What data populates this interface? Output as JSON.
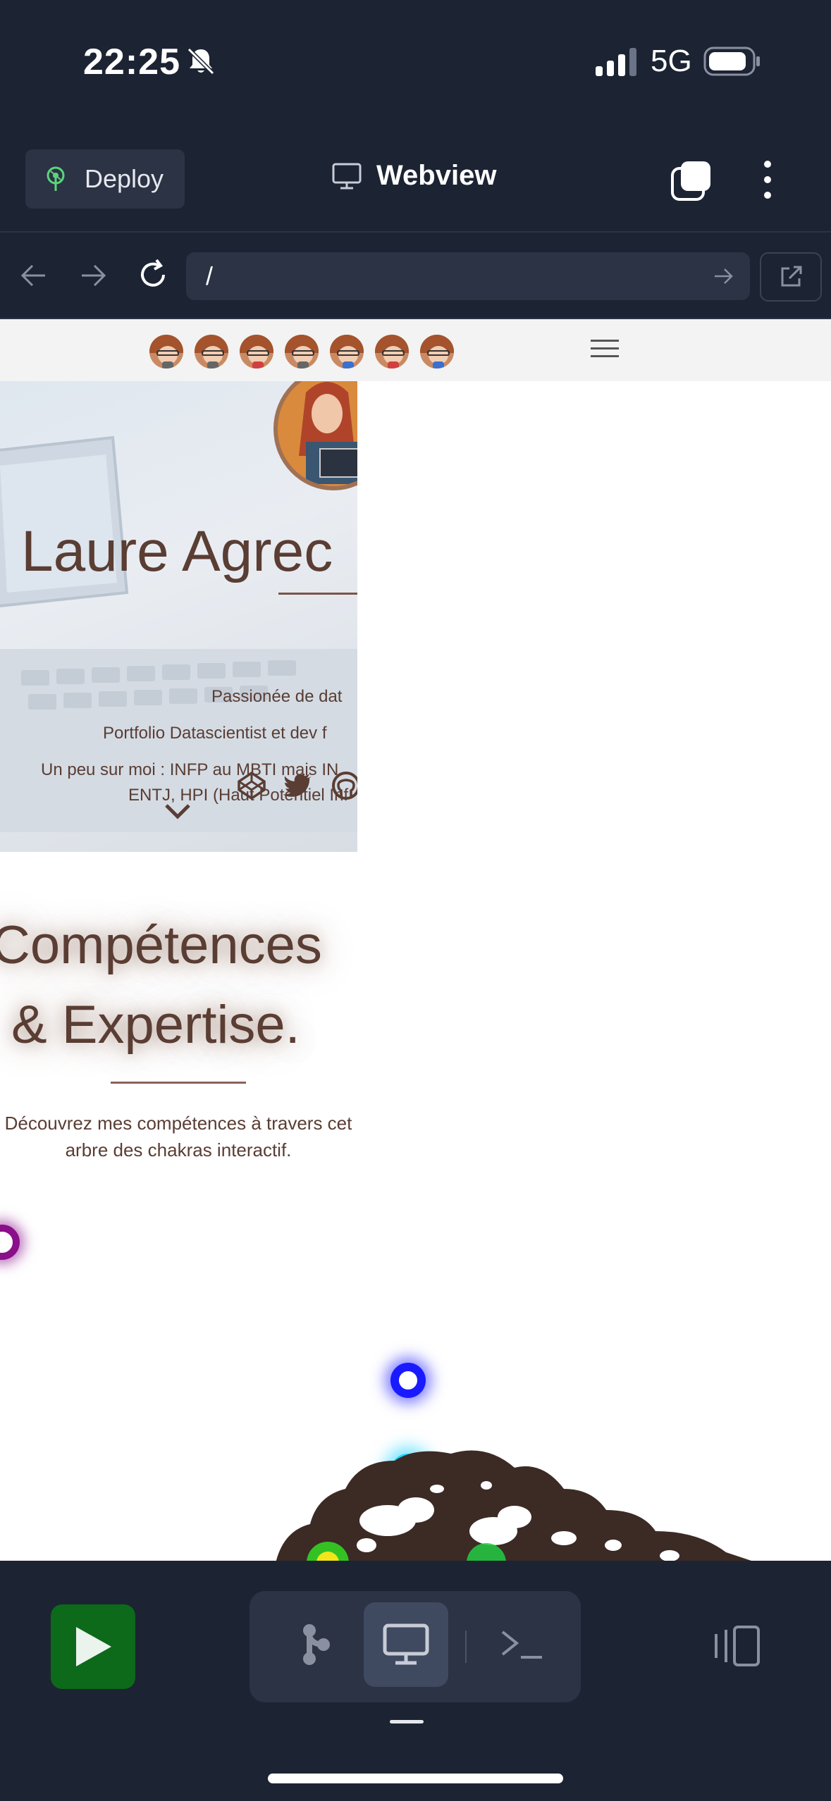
{
  "status_bar": {
    "time": "22:25",
    "network": "5G"
  },
  "header": {
    "deploy_label": "Deploy",
    "title": "Webview"
  },
  "url_bar": {
    "value": "/"
  },
  "site": {
    "hero": {
      "name": "Laure Agrec",
      "line1": "Passionée de dat",
      "line2": "Portfolio Datascientist et dev f",
      "line3": "Un peu sur moi : INFP au MBTI mais IN",
      "line4": "ENTJ, HPI (Haut Potentiel Inf"
    },
    "skills": {
      "title_line1": "Compétences",
      "title_line2": "& Expertise.",
      "description": "Découvrez mes compétences à travers cet arbre des chakras interactif."
    },
    "chakra_colors": [
      "#8a0f8a",
      "#1a1aff",
      "#22d4ff",
      "#33dd22",
      "#f2e51a",
      "#22cc44"
    ]
  },
  "colors": {
    "app_bg": "#1c2333",
    "surface": "#2b3345",
    "run_green": "#0c6a1a",
    "site_text": "#5a3d33"
  }
}
